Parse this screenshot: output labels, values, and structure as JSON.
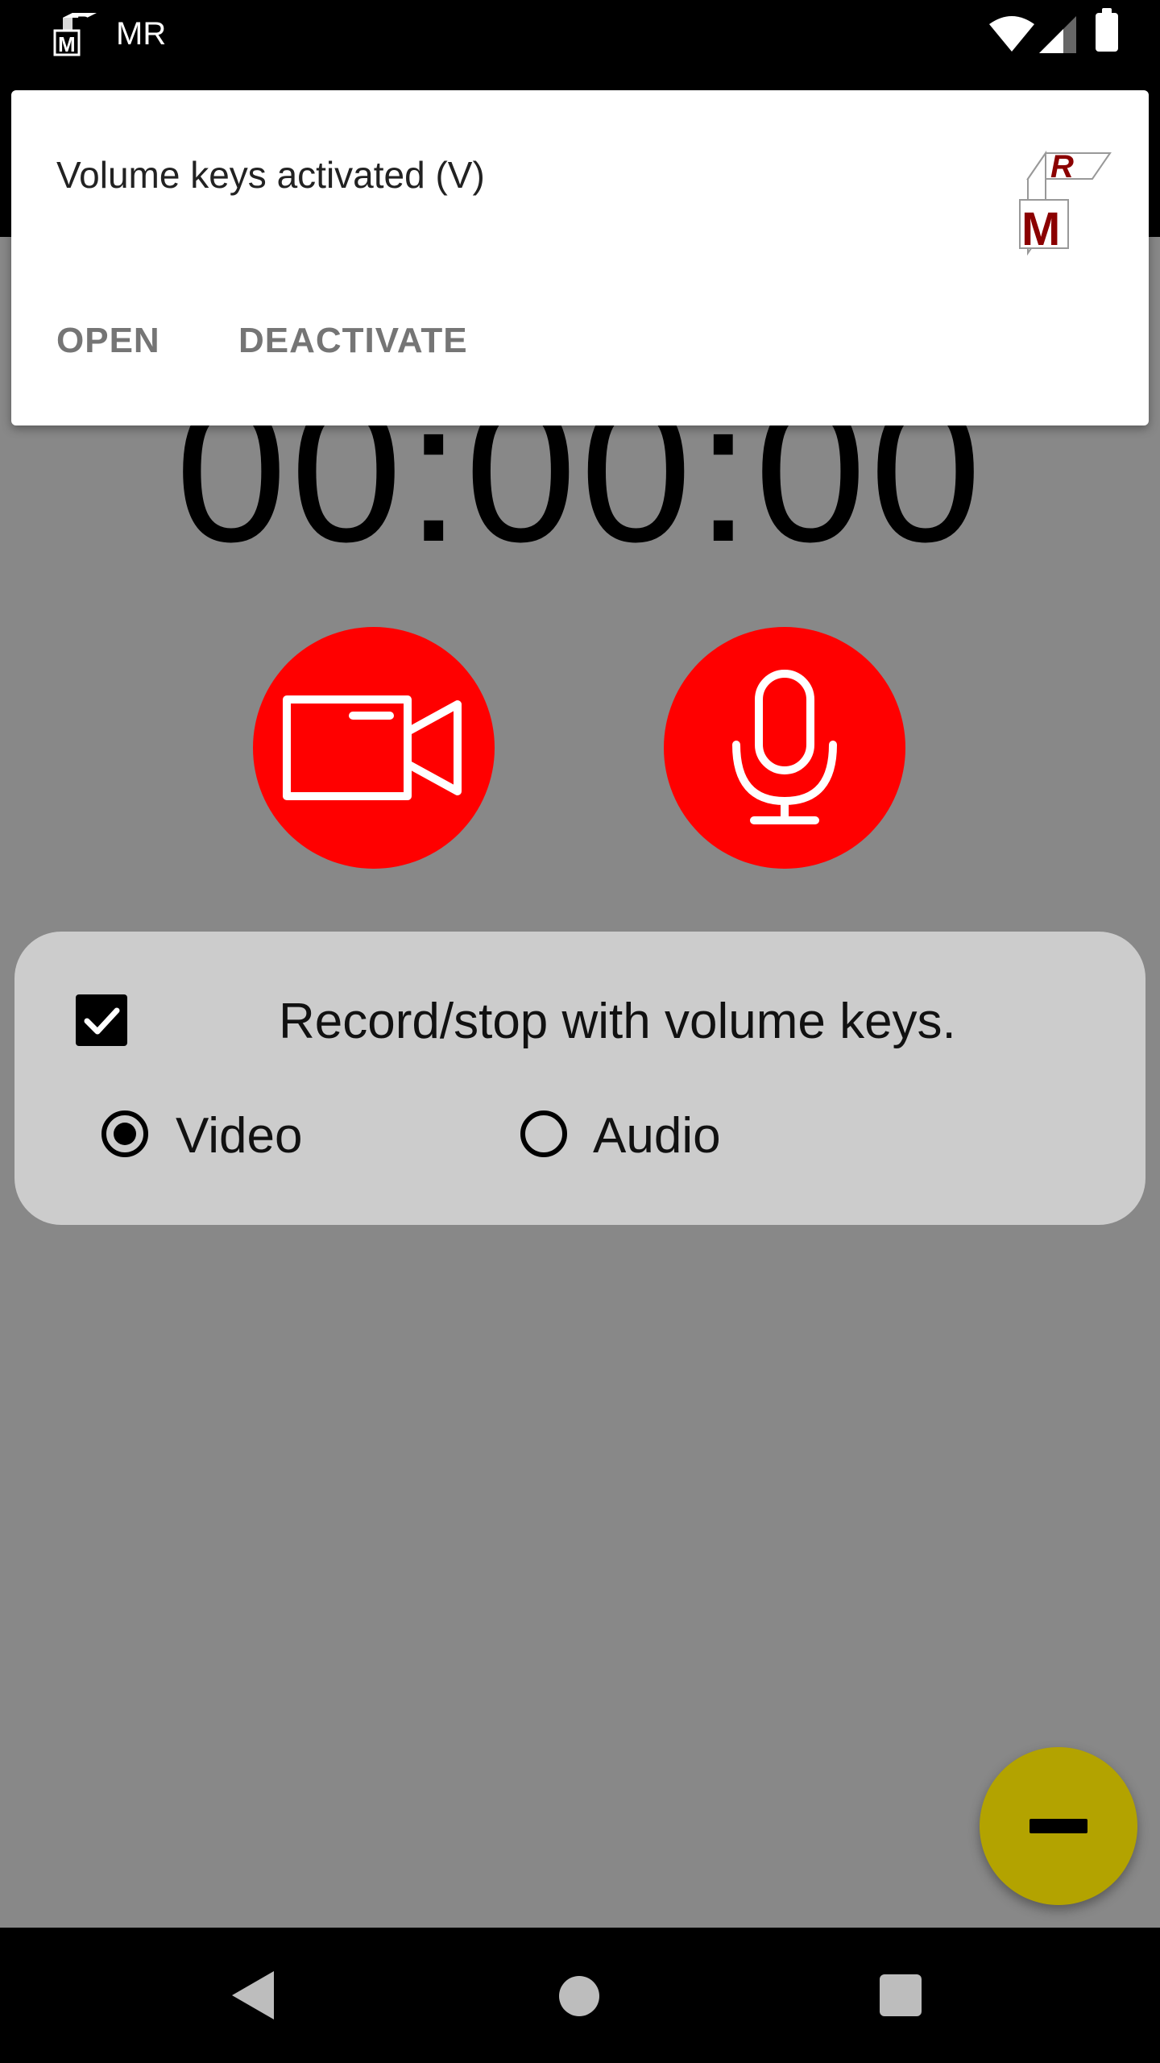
{
  "status_bar": {
    "app_label": "MR",
    "icons": [
      "mr-logo-icon",
      "wifi-icon",
      "cell-signal-icon",
      "battery-icon"
    ]
  },
  "notification": {
    "title": "Volume keys activated (V)",
    "open_label": "OPEN",
    "deactivate_label": "DEACTIVATE",
    "logo_icon": "mr-logo-icon"
  },
  "timer": {
    "value": "00:00:00"
  },
  "record_buttons": {
    "video_icon": "video-camera-icon",
    "audio_icon": "microphone-icon",
    "color": "#ff0000"
  },
  "options": {
    "volume_keys_label": "Record/stop with volume keys.",
    "volume_keys_checked": true,
    "video_label": "Video",
    "audio_label": "Audio",
    "selected": "Video"
  },
  "fab": {
    "icon": "minus-icon",
    "color": "#b3a300"
  },
  "nav_bar": {
    "icons": [
      "back-icon",
      "home-icon",
      "recents-icon"
    ]
  },
  "colors": {
    "background": "#888888",
    "panel": "#cccccc",
    "accent": "#ff0000"
  }
}
